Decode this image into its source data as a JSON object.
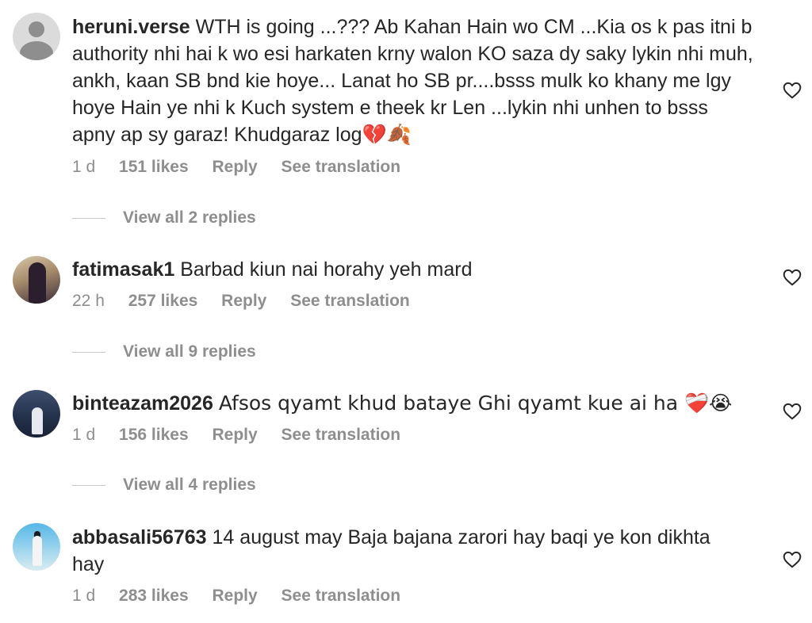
{
  "comments": [
    {
      "username": "heruni.verse",
      "text": "WTH is going ...??? Ab Kahan Hain wo CM ...Kia os k pas itni b authority nhi hai k wo esi harkaten krny walon KO saza dy saky lykin nhi muh, ankh, kaan SB bnd kie hoye... Lanat ho SB pr....bsss mulk ko khany me lgy hoye Hain ye nhi k Kuch system e theek kr Len ...lykin nhi unhen to bsss apny ap sy garaz! Khudgaraz log💔🍂",
      "time": "1 d",
      "likes": "151 likes",
      "reply": "Reply",
      "translate": "See translation",
      "replies": "View all 2 replies",
      "avatar": "default-avatar-icon"
    },
    {
      "username": "fatimasak1",
      "text": "Barbad kiun nai horahy yeh mard",
      "time": "22 h",
      "likes": "257 likes",
      "reply": "Reply",
      "translate": "See translation",
      "replies": "View all 9 replies",
      "avatar": "photo-avatar"
    },
    {
      "username": "binteazam2026",
      "text": "Afsos qyamt khud bataye Ghi qyamt kue ai ha ❤️‍🩹😭",
      "time": "1 d",
      "likes": "156 likes",
      "reply": "Reply",
      "translate": "See translation",
      "replies": "View all 4 replies",
      "avatar": "photo-avatar"
    },
    {
      "username": "abbasali56763",
      "text": "14 august may Baja bajana zarori hay baqi ye kon dikhta hay",
      "time": "1 d",
      "likes": "283 likes",
      "reply": "Reply",
      "translate": "See translation",
      "avatar": "photo-avatar"
    }
  ],
  "icons": {
    "like": "heart-outline-icon"
  },
  "colors": {
    "text": "#262626",
    "secondary": "#8e8e8e"
  }
}
